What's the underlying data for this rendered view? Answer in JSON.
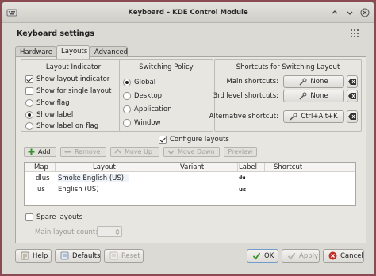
{
  "window": {
    "title": "Keyboard – KDE Control Module"
  },
  "heading": "Keyboard settings",
  "tabs": [
    {
      "label": "Hardware",
      "active": false
    },
    {
      "label": "Layouts",
      "active": true
    },
    {
      "label": "Advanced",
      "active": false
    }
  ],
  "layout_indicator": {
    "title": "Layout Indicator",
    "options": [
      {
        "label": "Show layout indicator",
        "checked": true
      },
      {
        "label": "Show for single layout",
        "checked": false
      },
      {
        "label": "Show flag",
        "checked": false
      },
      {
        "label": "Show label",
        "checked": true
      },
      {
        "label": "Show label on flag",
        "checked": false
      }
    ]
  },
  "switching_policy": {
    "title": "Switching Policy",
    "options": [
      {
        "label": "Global",
        "selected": true
      },
      {
        "label": "Desktop",
        "selected": false
      },
      {
        "label": "Application",
        "selected": false
      },
      {
        "label": "Window",
        "selected": false
      }
    ]
  },
  "shortcuts": {
    "title": "Shortcuts for Switching Layout",
    "main_label": "Main shortcuts:",
    "main_value": "None",
    "third_label": "3rd level shortcuts:",
    "third_value": "None",
    "alt_label": "Alternative shortcut:",
    "alt_value": "Ctrl+Alt+K"
  },
  "configure_layouts": {
    "label": "Configure layouts",
    "checked": true
  },
  "toolbar": {
    "add": "Add",
    "remove": "Remove",
    "move_up": "Move Up",
    "move_down": "Move Down",
    "preview": "Preview"
  },
  "table": {
    "headers": {
      "map": "Map",
      "layout": "Layout",
      "variant": "Variant",
      "label": "Label",
      "shortcut": "Shortcut"
    },
    "rows": [
      {
        "map": "dlus",
        "layout": "Smoke English (US)",
        "variant": "",
        "label": "du",
        "shortcut": ""
      },
      {
        "map": "us",
        "layout": "English (US)",
        "variant": "",
        "label": "us",
        "shortcut": ""
      }
    ]
  },
  "spare_layouts": {
    "label": "Spare layouts",
    "checked": false
  },
  "main_layout_count": {
    "label": "Main layout count:"
  },
  "footer": {
    "help": "Help",
    "defaults": "Defaults",
    "reset": "Reset",
    "ok": "OK",
    "apply": "Apply",
    "cancel": "Cancel"
  },
  "colors": {
    "window_bg": "#dcdad5",
    "panel_bg": "#e8e6e1",
    "red_icon": "#c0302a",
    "green_icon": "#3c8f2e",
    "blue_accent": "#6f9ccd"
  }
}
